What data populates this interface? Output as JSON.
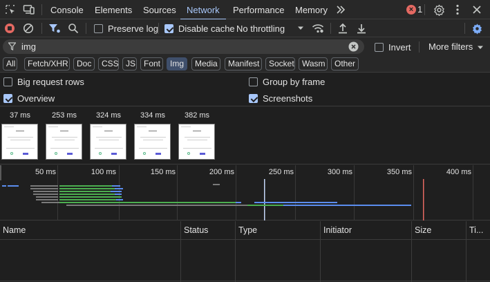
{
  "tabbar": {
    "tabs": [
      {
        "label": "Console"
      },
      {
        "label": "Elements"
      },
      {
        "label": "Sources"
      },
      {
        "label": "Network"
      },
      {
        "label": "Performance"
      },
      {
        "label": "Memory"
      }
    ],
    "active_tab": "Network",
    "error_count": "1",
    "icons": [
      "inspect-element-icon",
      "device-toolbar-icon",
      "more-tabs-icon",
      "error-icon",
      "settings-gear-icon",
      "more-options-icon",
      "close-icon"
    ]
  },
  "toolbar": {
    "preserve_log": {
      "label": "Preserve log",
      "checked": false
    },
    "disable_cache": {
      "label": "Disable cache",
      "checked": true
    },
    "throttling": "No throttling",
    "icons": [
      "record-stop-icon",
      "clear-icon",
      "filter-icon",
      "search-icon",
      "wifi-conditions-icon",
      "import-har-icon",
      "export-har-icon",
      "network-settings-gear-icon"
    ]
  },
  "filter": {
    "value": "img",
    "invert": {
      "label": "Invert",
      "checked": false
    },
    "more_filters": "More filters"
  },
  "type_chips": [
    {
      "label": "All",
      "selected": false
    },
    {
      "label": "Fetch/XHR",
      "selected": false
    },
    {
      "label": "Doc",
      "selected": false
    },
    {
      "label": "CSS",
      "selected": false
    },
    {
      "label": "JS",
      "selected": false
    },
    {
      "label": "Font",
      "selected": false
    },
    {
      "label": "Img",
      "selected": true
    },
    {
      "label": "Media",
      "selected": false
    },
    {
      "label": "Manifest",
      "selected": false
    },
    {
      "label": "Socket",
      "selected": false
    },
    {
      "label": "Wasm",
      "selected": false
    },
    {
      "label": "Other",
      "selected": false
    }
  ],
  "options": {
    "big_request_rows": {
      "label": "Big request rows",
      "checked": false
    },
    "group_by_frame": {
      "label": "Group by frame",
      "checked": false
    },
    "overview": {
      "label": "Overview",
      "checked": true
    },
    "screenshots": {
      "label": "Screenshots",
      "checked": true
    }
  },
  "screenshots": [
    {
      "time": "37 ms"
    },
    {
      "time": "253 ms"
    },
    {
      "time": "324 ms"
    },
    {
      "time": "334 ms"
    },
    {
      "time": "382 ms"
    }
  ],
  "overview": {
    "ticks": [
      "50 ms",
      "100 ms",
      "150 ms",
      "200 ms",
      "250 ms",
      "300 ms",
      "350 ms",
      "400 ms"
    ],
    "colors": {
      "waiting": "#4caf50",
      "download": "#5b8def",
      "queued": "#7a7a7a",
      "dom_content_loaded": "#c5d7f9",
      "load": "#e46962"
    }
  },
  "table": {
    "columns": [
      {
        "label": "Name"
      },
      {
        "label": "Status"
      },
      {
        "label": "Type"
      },
      {
        "label": "Initiator"
      },
      {
        "label": "Size"
      },
      {
        "label": "Ti..."
      }
    ]
  }
}
